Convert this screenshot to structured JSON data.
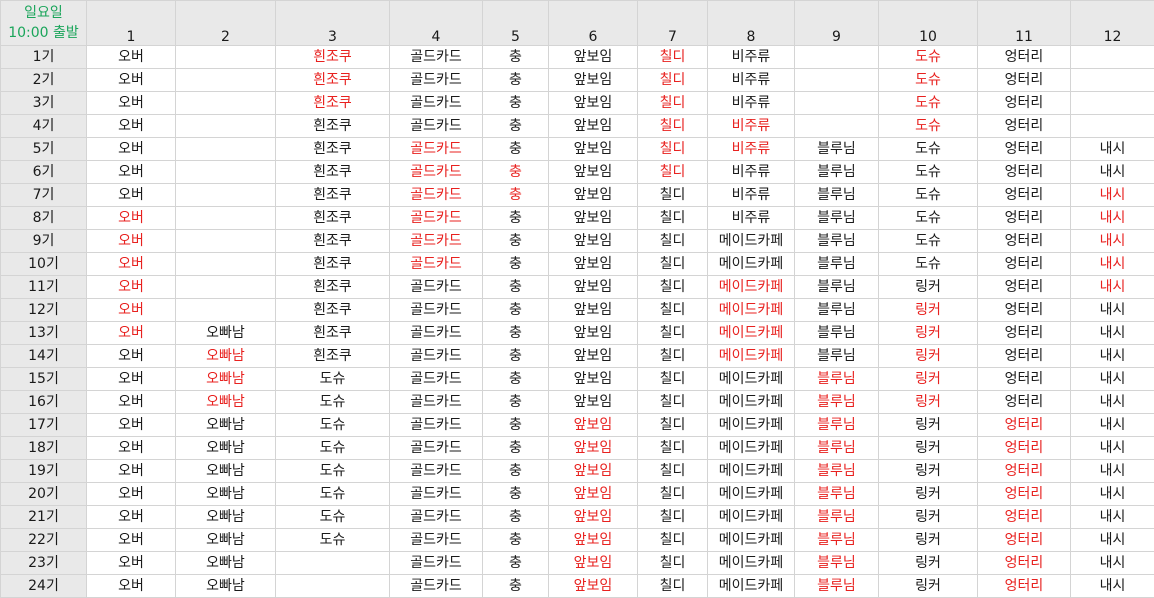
{
  "corner": {
    "line1": "일요일",
    "line2": "10:00 출발"
  },
  "corner_color": "#1aa55a",
  "highlight_color": "#e8211f",
  "columns": [
    "1",
    "2",
    "3",
    "4",
    "5",
    "6",
    "7",
    "8",
    "9",
    "10",
    "11",
    "12"
  ],
  "rows": [
    {
      "label": "1기",
      "cells": [
        {
          "t": "오버",
          "r": 0
        },
        {
          "t": "",
          "r": 0
        },
        {
          "t": "흰조쿠",
          "r": 1
        },
        {
          "t": "골드카드",
          "r": 0
        },
        {
          "t": "충",
          "r": 0
        },
        {
          "t": "앞보임",
          "r": 0
        },
        {
          "t": "칠디",
          "r": 1
        },
        {
          "t": "비주류",
          "r": 0
        },
        {
          "t": "",
          "r": 0
        },
        {
          "t": "도슈",
          "r": 1
        },
        {
          "t": "엉터리",
          "r": 0
        },
        {
          "t": "",
          "r": 0
        }
      ]
    },
    {
      "label": "2기",
      "cells": [
        {
          "t": "오버",
          "r": 0
        },
        {
          "t": "",
          "r": 0
        },
        {
          "t": "흰조쿠",
          "r": 1
        },
        {
          "t": "골드카드",
          "r": 0
        },
        {
          "t": "충",
          "r": 0
        },
        {
          "t": "앞보임",
          "r": 0
        },
        {
          "t": "칠디",
          "r": 1
        },
        {
          "t": "비주류",
          "r": 0
        },
        {
          "t": "",
          "r": 0
        },
        {
          "t": "도슈",
          "r": 1
        },
        {
          "t": "엉터리",
          "r": 0
        },
        {
          "t": "",
          "r": 0
        }
      ]
    },
    {
      "label": "3기",
      "cells": [
        {
          "t": "오버",
          "r": 0
        },
        {
          "t": "",
          "r": 0
        },
        {
          "t": "흰조쿠",
          "r": 1
        },
        {
          "t": "골드카드",
          "r": 0
        },
        {
          "t": "충",
          "r": 0
        },
        {
          "t": "앞보임",
          "r": 0
        },
        {
          "t": "칠디",
          "r": 1
        },
        {
          "t": "비주류",
          "r": 0
        },
        {
          "t": "",
          "r": 0
        },
        {
          "t": "도슈",
          "r": 1
        },
        {
          "t": "엉터리",
          "r": 0
        },
        {
          "t": "",
          "r": 0
        }
      ]
    },
    {
      "label": "4기",
      "cells": [
        {
          "t": "오버",
          "r": 0
        },
        {
          "t": "",
          "r": 0
        },
        {
          "t": "흰조쿠",
          "r": 0
        },
        {
          "t": "골드카드",
          "r": 0
        },
        {
          "t": "충",
          "r": 0
        },
        {
          "t": "앞보임",
          "r": 0
        },
        {
          "t": "칠디",
          "r": 1
        },
        {
          "t": "비주류",
          "r": 1
        },
        {
          "t": "",
          "r": 0
        },
        {
          "t": "도슈",
          "r": 1
        },
        {
          "t": "엉터리",
          "r": 0
        },
        {
          "t": "",
          "r": 0
        }
      ]
    },
    {
      "label": "5기",
      "cells": [
        {
          "t": "오버",
          "r": 0
        },
        {
          "t": "",
          "r": 0
        },
        {
          "t": "흰조쿠",
          "r": 0
        },
        {
          "t": "골드카드",
          "r": 1
        },
        {
          "t": "충",
          "r": 0
        },
        {
          "t": "앞보임",
          "r": 0
        },
        {
          "t": "칠디",
          "r": 1
        },
        {
          "t": "비주류",
          "r": 1
        },
        {
          "t": "블루님",
          "r": 0
        },
        {
          "t": "도슈",
          "r": 0
        },
        {
          "t": "엉터리",
          "r": 0
        },
        {
          "t": "내시",
          "r": 0
        }
      ]
    },
    {
      "label": "6기",
      "cells": [
        {
          "t": "오버",
          "r": 0
        },
        {
          "t": "",
          "r": 0
        },
        {
          "t": "흰조쿠",
          "r": 0
        },
        {
          "t": "골드카드",
          "r": 1
        },
        {
          "t": "충",
          "r": 1
        },
        {
          "t": "앞보임",
          "r": 0
        },
        {
          "t": "칠디",
          "r": 1
        },
        {
          "t": "비주류",
          "r": 0
        },
        {
          "t": "블루님",
          "r": 0
        },
        {
          "t": "도슈",
          "r": 0
        },
        {
          "t": "엉터리",
          "r": 0
        },
        {
          "t": "내시",
          "r": 0
        }
      ]
    },
    {
      "label": "7기",
      "cells": [
        {
          "t": "오버",
          "r": 0
        },
        {
          "t": "",
          "r": 0
        },
        {
          "t": "흰조쿠",
          "r": 0
        },
        {
          "t": "골드카드",
          "r": 1
        },
        {
          "t": "충",
          "r": 1
        },
        {
          "t": "앞보임",
          "r": 0
        },
        {
          "t": "칠디",
          "r": 0
        },
        {
          "t": "비주류",
          "r": 0
        },
        {
          "t": "블루님",
          "r": 0
        },
        {
          "t": "도슈",
          "r": 0
        },
        {
          "t": "엉터리",
          "r": 0
        },
        {
          "t": "내시",
          "r": 1
        }
      ]
    },
    {
      "label": "8기",
      "cells": [
        {
          "t": "오버",
          "r": 1
        },
        {
          "t": "",
          "r": 0
        },
        {
          "t": "흰조쿠",
          "r": 0
        },
        {
          "t": "골드카드",
          "r": 1
        },
        {
          "t": "충",
          "r": 0
        },
        {
          "t": "앞보임",
          "r": 0
        },
        {
          "t": "칠디",
          "r": 0
        },
        {
          "t": "비주류",
          "r": 0
        },
        {
          "t": "블루님",
          "r": 0
        },
        {
          "t": "도슈",
          "r": 0
        },
        {
          "t": "엉터리",
          "r": 0
        },
        {
          "t": "내시",
          "r": 1
        }
      ]
    },
    {
      "label": "9기",
      "cells": [
        {
          "t": "오버",
          "r": 1
        },
        {
          "t": "",
          "r": 0
        },
        {
          "t": "흰조쿠",
          "r": 0
        },
        {
          "t": "골드카드",
          "r": 1
        },
        {
          "t": "충",
          "r": 0
        },
        {
          "t": "앞보임",
          "r": 0
        },
        {
          "t": "칠디",
          "r": 0
        },
        {
          "t": "메이드카페",
          "r": 0
        },
        {
          "t": "블루님",
          "r": 0
        },
        {
          "t": "도슈",
          "r": 0
        },
        {
          "t": "엉터리",
          "r": 0
        },
        {
          "t": "내시",
          "r": 1
        }
      ]
    },
    {
      "label": "10기",
      "cells": [
        {
          "t": "오버",
          "r": 1
        },
        {
          "t": "",
          "r": 0
        },
        {
          "t": "흰조쿠",
          "r": 0
        },
        {
          "t": "골드카드",
          "r": 1
        },
        {
          "t": "충",
          "r": 0
        },
        {
          "t": "앞보임",
          "r": 0
        },
        {
          "t": "칠디",
          "r": 0
        },
        {
          "t": "메이드카페",
          "r": 0
        },
        {
          "t": "블루님",
          "r": 0
        },
        {
          "t": "도슈",
          "r": 0
        },
        {
          "t": "엉터리",
          "r": 0
        },
        {
          "t": "내시",
          "r": 1
        }
      ]
    },
    {
      "label": "11기",
      "cells": [
        {
          "t": "오버",
          "r": 1
        },
        {
          "t": "",
          "r": 0
        },
        {
          "t": "흰조쿠",
          "r": 0
        },
        {
          "t": "골드카드",
          "r": 0
        },
        {
          "t": "충",
          "r": 0
        },
        {
          "t": "앞보임",
          "r": 0
        },
        {
          "t": "칠디",
          "r": 0
        },
        {
          "t": "메이드카페",
          "r": 1
        },
        {
          "t": "블루님",
          "r": 0
        },
        {
          "t": "링커",
          "r": 0
        },
        {
          "t": "엉터리",
          "r": 0
        },
        {
          "t": "내시",
          "r": 1
        }
      ]
    },
    {
      "label": "12기",
      "cells": [
        {
          "t": "오버",
          "r": 1
        },
        {
          "t": "",
          "r": 0
        },
        {
          "t": "흰조쿠",
          "r": 0
        },
        {
          "t": "골드카드",
          "r": 0
        },
        {
          "t": "충",
          "r": 0
        },
        {
          "t": "앞보임",
          "r": 0
        },
        {
          "t": "칠디",
          "r": 0
        },
        {
          "t": "메이드카페",
          "r": 1
        },
        {
          "t": "블루님",
          "r": 0
        },
        {
          "t": "링커",
          "r": 1
        },
        {
          "t": "엉터리",
          "r": 0
        },
        {
          "t": "내시",
          "r": 0
        }
      ]
    },
    {
      "label": "13기",
      "cells": [
        {
          "t": "오버",
          "r": 1
        },
        {
          "t": "오빠남",
          "r": 0
        },
        {
          "t": "흰조쿠",
          "r": 0
        },
        {
          "t": "골드카드",
          "r": 0
        },
        {
          "t": "충",
          "r": 0
        },
        {
          "t": "앞보임",
          "r": 0
        },
        {
          "t": "칠디",
          "r": 0
        },
        {
          "t": "메이드카페",
          "r": 1
        },
        {
          "t": "블루님",
          "r": 0
        },
        {
          "t": "링커",
          "r": 1
        },
        {
          "t": "엉터리",
          "r": 0
        },
        {
          "t": "내시",
          "r": 0
        }
      ]
    },
    {
      "label": "14기",
      "cells": [
        {
          "t": "오버",
          "r": 0
        },
        {
          "t": "오빠남",
          "r": 1
        },
        {
          "t": "흰조쿠",
          "r": 0
        },
        {
          "t": "골드카드",
          "r": 0
        },
        {
          "t": "충",
          "r": 0
        },
        {
          "t": "앞보임",
          "r": 0
        },
        {
          "t": "칠디",
          "r": 0
        },
        {
          "t": "메이드카페",
          "r": 1
        },
        {
          "t": "블루님",
          "r": 0
        },
        {
          "t": "링커",
          "r": 1
        },
        {
          "t": "엉터리",
          "r": 0
        },
        {
          "t": "내시",
          "r": 0
        }
      ]
    },
    {
      "label": "15기",
      "cells": [
        {
          "t": "오버",
          "r": 0
        },
        {
          "t": "오빠남",
          "r": 1
        },
        {
          "t": "도슈",
          "r": 0
        },
        {
          "t": "골드카드",
          "r": 0
        },
        {
          "t": "충",
          "r": 0
        },
        {
          "t": "앞보임",
          "r": 0
        },
        {
          "t": "칠디",
          "r": 0
        },
        {
          "t": "메이드카페",
          "r": 0
        },
        {
          "t": "블루님",
          "r": 1
        },
        {
          "t": "링커",
          "r": 1
        },
        {
          "t": "엉터리",
          "r": 0
        },
        {
          "t": "내시",
          "r": 0
        }
      ]
    },
    {
      "label": "16기",
      "cells": [
        {
          "t": "오버",
          "r": 0
        },
        {
          "t": "오빠남",
          "r": 1
        },
        {
          "t": "도슈",
          "r": 0
        },
        {
          "t": "골드카드",
          "r": 0
        },
        {
          "t": "충",
          "r": 0
        },
        {
          "t": "앞보임",
          "r": 0
        },
        {
          "t": "칠디",
          "r": 0
        },
        {
          "t": "메이드카페",
          "r": 0
        },
        {
          "t": "블루님",
          "r": 1
        },
        {
          "t": "링커",
          "r": 1
        },
        {
          "t": "엉터리",
          "r": 0
        },
        {
          "t": "내시",
          "r": 0
        }
      ]
    },
    {
      "label": "17기",
      "cells": [
        {
          "t": "오버",
          "r": 0
        },
        {
          "t": "오빠남",
          "r": 0
        },
        {
          "t": "도슈",
          "r": 0
        },
        {
          "t": "골드카드",
          "r": 0
        },
        {
          "t": "충",
          "r": 0
        },
        {
          "t": "앞보임",
          "r": 1
        },
        {
          "t": "칠디",
          "r": 0
        },
        {
          "t": "메이드카페",
          "r": 0
        },
        {
          "t": "블루님",
          "r": 1
        },
        {
          "t": "링커",
          "r": 0
        },
        {
          "t": "엉터리",
          "r": 1
        },
        {
          "t": "내시",
          "r": 0
        }
      ]
    },
    {
      "label": "18기",
      "cells": [
        {
          "t": "오버",
          "r": 0
        },
        {
          "t": "오빠남",
          "r": 0
        },
        {
          "t": "도슈",
          "r": 0
        },
        {
          "t": "골드카드",
          "r": 0
        },
        {
          "t": "충",
          "r": 0
        },
        {
          "t": "앞보임",
          "r": 1
        },
        {
          "t": "칠디",
          "r": 0
        },
        {
          "t": "메이드카페",
          "r": 0
        },
        {
          "t": "블루님",
          "r": 1
        },
        {
          "t": "링커",
          "r": 0
        },
        {
          "t": "엉터리",
          "r": 1
        },
        {
          "t": "내시",
          "r": 0
        }
      ]
    },
    {
      "label": "19기",
      "cells": [
        {
          "t": "오버",
          "r": 0
        },
        {
          "t": "오빠남",
          "r": 0
        },
        {
          "t": "도슈",
          "r": 0
        },
        {
          "t": "골드카드",
          "r": 0
        },
        {
          "t": "충",
          "r": 0
        },
        {
          "t": "앞보임",
          "r": 1
        },
        {
          "t": "칠디",
          "r": 0
        },
        {
          "t": "메이드카페",
          "r": 0
        },
        {
          "t": "블루님",
          "r": 1
        },
        {
          "t": "링커",
          "r": 0
        },
        {
          "t": "엉터리",
          "r": 1
        },
        {
          "t": "내시",
          "r": 0
        }
      ]
    },
    {
      "label": "20기",
      "cells": [
        {
          "t": "오버",
          "r": 0
        },
        {
          "t": "오빠남",
          "r": 0
        },
        {
          "t": "도슈",
          "r": 0
        },
        {
          "t": "골드카드",
          "r": 0
        },
        {
          "t": "충",
          "r": 0
        },
        {
          "t": "앞보임",
          "r": 1
        },
        {
          "t": "칠디",
          "r": 0
        },
        {
          "t": "메이드카페",
          "r": 0
        },
        {
          "t": "블루님",
          "r": 1
        },
        {
          "t": "링커",
          "r": 0
        },
        {
          "t": "엉터리",
          "r": 1
        },
        {
          "t": "내시",
          "r": 0
        }
      ]
    },
    {
      "label": "21기",
      "cells": [
        {
          "t": "오버",
          "r": 0
        },
        {
          "t": "오빠남",
          "r": 0
        },
        {
          "t": "도슈",
          "r": 0
        },
        {
          "t": "골드카드",
          "r": 0
        },
        {
          "t": "충",
          "r": 0
        },
        {
          "t": "앞보임",
          "r": 1
        },
        {
          "t": "칠디",
          "r": 0
        },
        {
          "t": "메이드카페",
          "r": 0
        },
        {
          "t": "블루님",
          "r": 1
        },
        {
          "t": "링커",
          "r": 0
        },
        {
          "t": "엉터리",
          "r": 1
        },
        {
          "t": "내시",
          "r": 0
        }
      ]
    },
    {
      "label": "22기",
      "cells": [
        {
          "t": "오버",
          "r": 0
        },
        {
          "t": "오빠남",
          "r": 0
        },
        {
          "t": "도슈",
          "r": 0
        },
        {
          "t": "골드카드",
          "r": 0
        },
        {
          "t": "충",
          "r": 0
        },
        {
          "t": "앞보임",
          "r": 1
        },
        {
          "t": "칠디",
          "r": 0
        },
        {
          "t": "메이드카페",
          "r": 0
        },
        {
          "t": "블루님",
          "r": 1
        },
        {
          "t": "링커",
          "r": 0
        },
        {
          "t": "엉터리",
          "r": 1
        },
        {
          "t": "내시",
          "r": 0
        }
      ]
    },
    {
      "label": "23기",
      "cells": [
        {
          "t": "오버",
          "r": 0
        },
        {
          "t": "오빠남",
          "r": 0
        },
        {
          "t": "",
          "r": 0
        },
        {
          "t": "골드카드",
          "r": 0
        },
        {
          "t": "충",
          "r": 0
        },
        {
          "t": "앞보임",
          "r": 1
        },
        {
          "t": "칠디",
          "r": 0
        },
        {
          "t": "메이드카페",
          "r": 0
        },
        {
          "t": "블루님",
          "r": 1
        },
        {
          "t": "링커",
          "r": 0
        },
        {
          "t": "엉터리",
          "r": 1
        },
        {
          "t": "내시",
          "r": 0
        }
      ]
    },
    {
      "label": "24기",
      "cells": [
        {
          "t": "오버",
          "r": 0
        },
        {
          "t": "오빠남",
          "r": 0
        },
        {
          "t": "",
          "r": 0
        },
        {
          "t": "골드카드",
          "r": 0
        },
        {
          "t": "충",
          "r": 0
        },
        {
          "t": "앞보임",
          "r": 1
        },
        {
          "t": "칠디",
          "r": 0
        },
        {
          "t": "메이드카페",
          "r": 0
        },
        {
          "t": "블루님",
          "r": 1
        },
        {
          "t": "링커",
          "r": 0
        },
        {
          "t": "엉터리",
          "r": 1
        },
        {
          "t": "내시",
          "r": 0
        }
      ]
    }
  ]
}
